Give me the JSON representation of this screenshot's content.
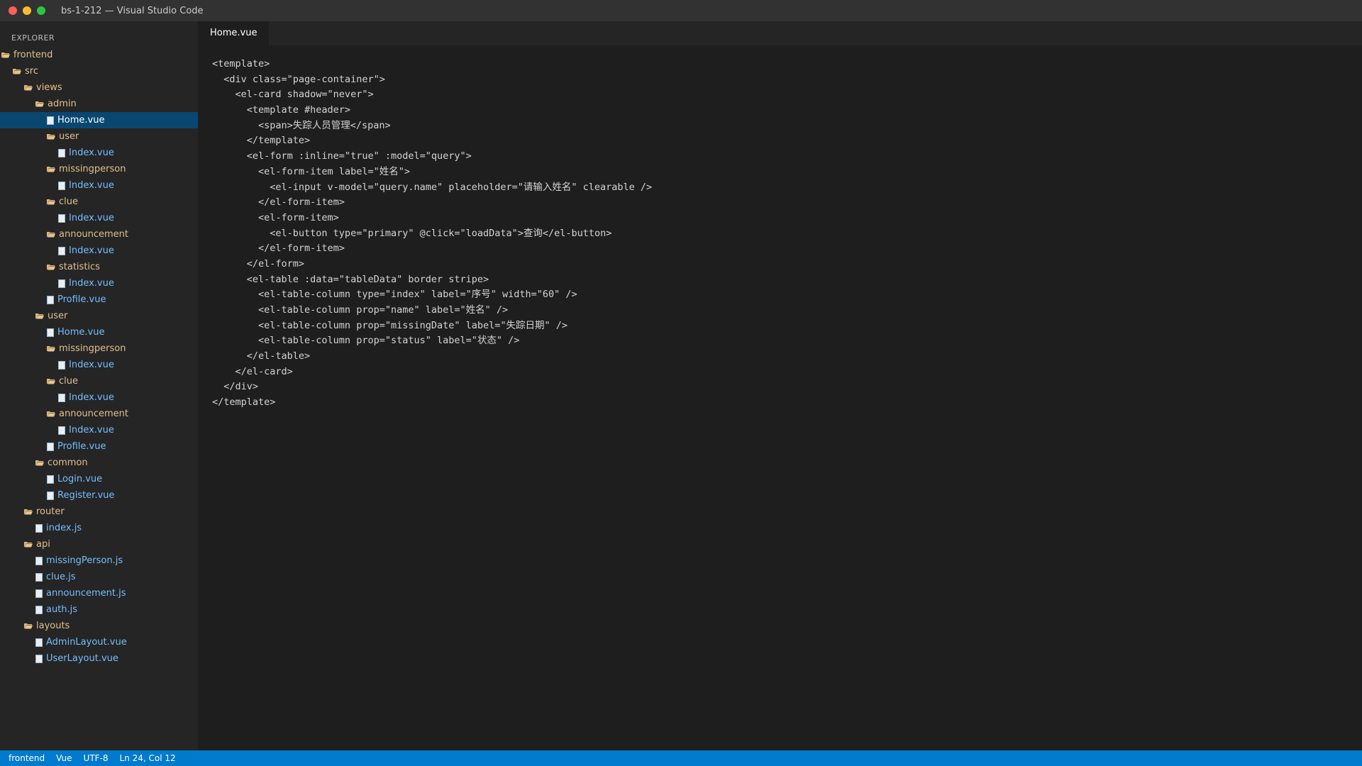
{
  "window": {
    "title": "bs-1-212 — Visual Studio Code",
    "traffic_colors": [
      "#ff5f57",
      "#febc2e",
      "#28c840"
    ]
  },
  "sidebar": {
    "title": "EXPLORER",
    "items": [
      {
        "label": "frontend",
        "type": "folder",
        "depth": 0
      },
      {
        "label": "src",
        "type": "folder",
        "depth": 1
      },
      {
        "label": "views",
        "type": "folder",
        "depth": 2
      },
      {
        "label": "admin",
        "type": "folder",
        "depth": 3
      },
      {
        "label": "Home.vue",
        "type": "file",
        "depth": 4,
        "selected": true
      },
      {
        "label": "user",
        "type": "folder",
        "depth": 4
      },
      {
        "label": "Index.vue",
        "type": "file",
        "depth": 5
      },
      {
        "label": "missingperson",
        "type": "folder",
        "depth": 4
      },
      {
        "label": "Index.vue",
        "type": "file",
        "depth": 5
      },
      {
        "label": "clue",
        "type": "folder",
        "depth": 4
      },
      {
        "label": "Index.vue",
        "type": "file",
        "depth": 5
      },
      {
        "label": "announcement",
        "type": "folder",
        "depth": 4
      },
      {
        "label": "Index.vue",
        "type": "file",
        "depth": 5
      },
      {
        "label": "statistics",
        "type": "folder",
        "depth": 4
      },
      {
        "label": "Index.vue",
        "type": "file",
        "depth": 5
      },
      {
        "label": "Profile.vue",
        "type": "file",
        "depth": 4
      },
      {
        "label": "user",
        "type": "folder",
        "depth": 3
      },
      {
        "label": "Home.vue",
        "type": "file",
        "depth": 4
      },
      {
        "label": "missingperson",
        "type": "folder",
        "depth": 4
      },
      {
        "label": "Index.vue",
        "type": "file",
        "depth": 5
      },
      {
        "label": "clue",
        "type": "folder",
        "depth": 4
      },
      {
        "label": "Index.vue",
        "type": "file",
        "depth": 5
      },
      {
        "label": "announcement",
        "type": "folder",
        "depth": 4
      },
      {
        "label": "Index.vue",
        "type": "file",
        "depth": 5
      },
      {
        "label": "Profile.vue",
        "type": "file",
        "depth": 4
      },
      {
        "label": "common",
        "type": "folder",
        "depth": 3
      },
      {
        "label": "Login.vue",
        "type": "file",
        "depth": 4
      },
      {
        "label": "Register.vue",
        "type": "file",
        "depth": 4
      },
      {
        "label": "router",
        "type": "folder",
        "depth": 2
      },
      {
        "label": "index.js",
        "type": "file",
        "depth": 3
      },
      {
        "label": "api",
        "type": "folder",
        "depth": 2
      },
      {
        "label": "missingPerson.js",
        "type": "file",
        "depth": 3
      },
      {
        "label": "clue.js",
        "type": "file",
        "depth": 3
      },
      {
        "label": "announcement.js",
        "type": "file",
        "depth": 3
      },
      {
        "label": "auth.js",
        "type": "file",
        "depth": 3
      },
      {
        "label": "layouts",
        "type": "folder",
        "depth": 2
      },
      {
        "label": "AdminLayout.vue",
        "type": "file",
        "depth": 3
      },
      {
        "label": "UserLayout.vue",
        "type": "file",
        "depth": 3
      }
    ]
  },
  "editor": {
    "tab_label": "Home.vue",
    "lines": [
      "<template>",
      "  <div class=\"page-container\">",
      "    <el-card shadow=\"never\">",
      "      <template #header>",
      "        <span>失踪人员管理</span>",
      "      </template>",
      "      <el-form :inline=\"true\" :model=\"query\">",
      "        <el-form-item label=\"姓名\">",
      "          <el-input v-model=\"query.name\" placeholder=\"请输入姓名\" clearable />",
      "        </el-form-item>",
      "        <el-form-item>",
      "          <el-button type=\"primary\" @click=\"loadData\">查询</el-button>",
      "        </el-form-item>",
      "      </el-form>",
      "      <el-table :data=\"tableData\" border stripe>",
      "        <el-table-column type=\"index\" label=\"序号\" width=\"60\" />",
      "        <el-table-column prop=\"name\" label=\"姓名\" />",
      "        <el-table-column prop=\"missingDate\" label=\"失踪日期\" />",
      "        <el-table-column prop=\"status\" label=\"状态\" />",
      "      </el-table>",
      "    </el-card>",
      "  </div>",
      "</template>"
    ]
  },
  "statusbar": {
    "folder": "frontend",
    "language": "Vue",
    "encoding": "UTF-8",
    "position": "Ln 24, Col 12"
  }
}
